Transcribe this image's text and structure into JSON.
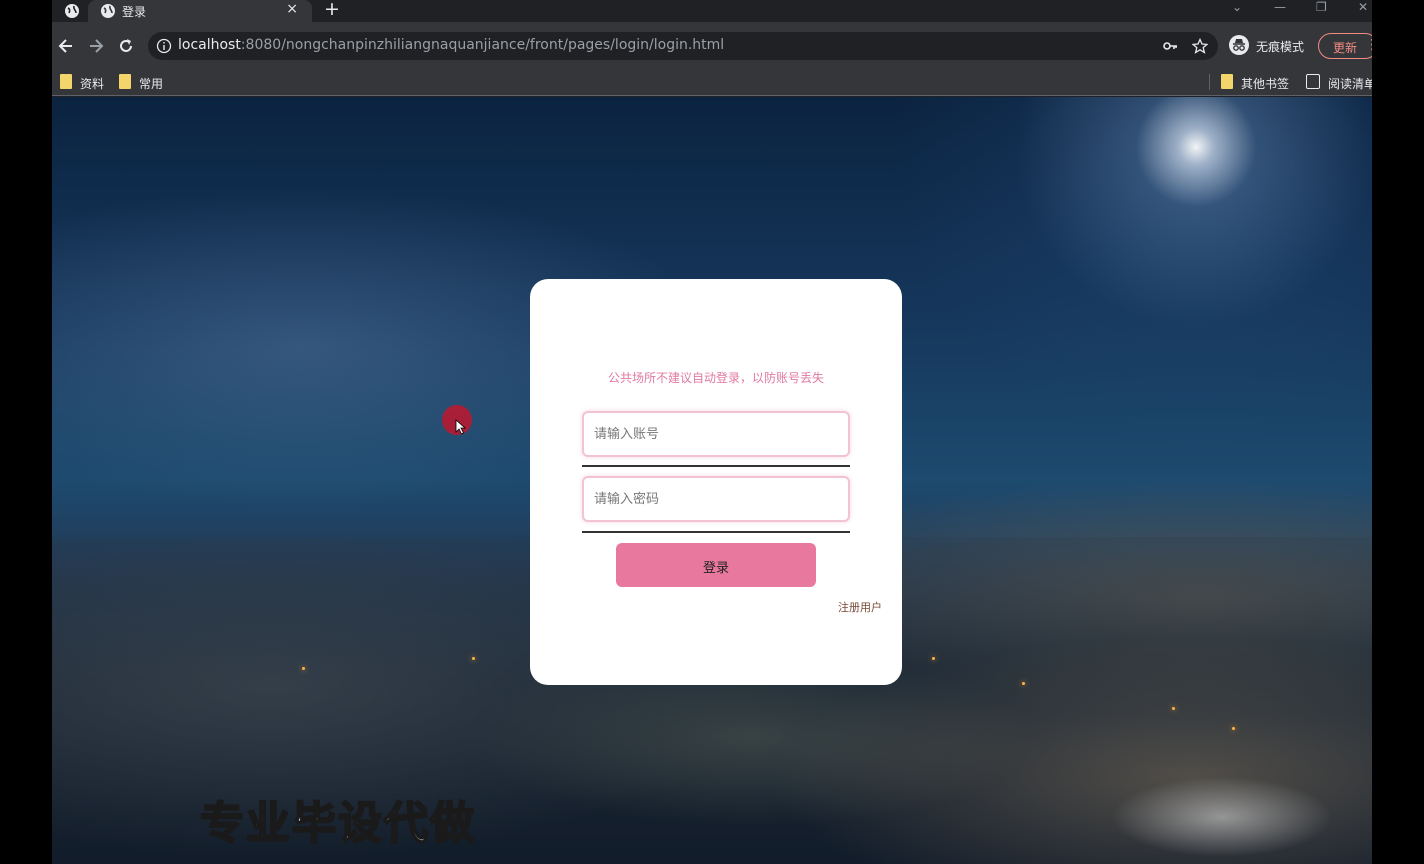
{
  "browser": {
    "tab": {
      "title": "登录",
      "close": "×"
    },
    "new_tab": "+",
    "window_controls": {
      "minimize": "—",
      "restore": "❐",
      "close": "✕"
    },
    "address_bar": {
      "host": "localhost",
      "path": ":8080/nongchanpinzhiliangnaquanjiance/front/pages/login/login.html"
    },
    "profile": {
      "label": "无痕模式"
    },
    "update": {
      "label": "更新",
      "menu": "⋮"
    },
    "bookmarks": [
      {
        "label": "资料"
      },
      {
        "label": "常用"
      }
    ],
    "other_bookmarks": "其他书签",
    "reading_list": "阅读清单"
  },
  "login": {
    "notice": "公共场所不建议自动登录，以防账号丢失",
    "account_placeholder": "请输入账号",
    "password_placeholder": "请输入密码",
    "login_button": "登录",
    "register_link": "注册用户"
  },
  "overlay": {
    "watermark": "专业毕设代做"
  },
  "colors": {
    "accent": "#e8789d",
    "notice_text": "#e07aa2",
    "register_link": "#7a4a36",
    "update_button": "#f28b82"
  }
}
